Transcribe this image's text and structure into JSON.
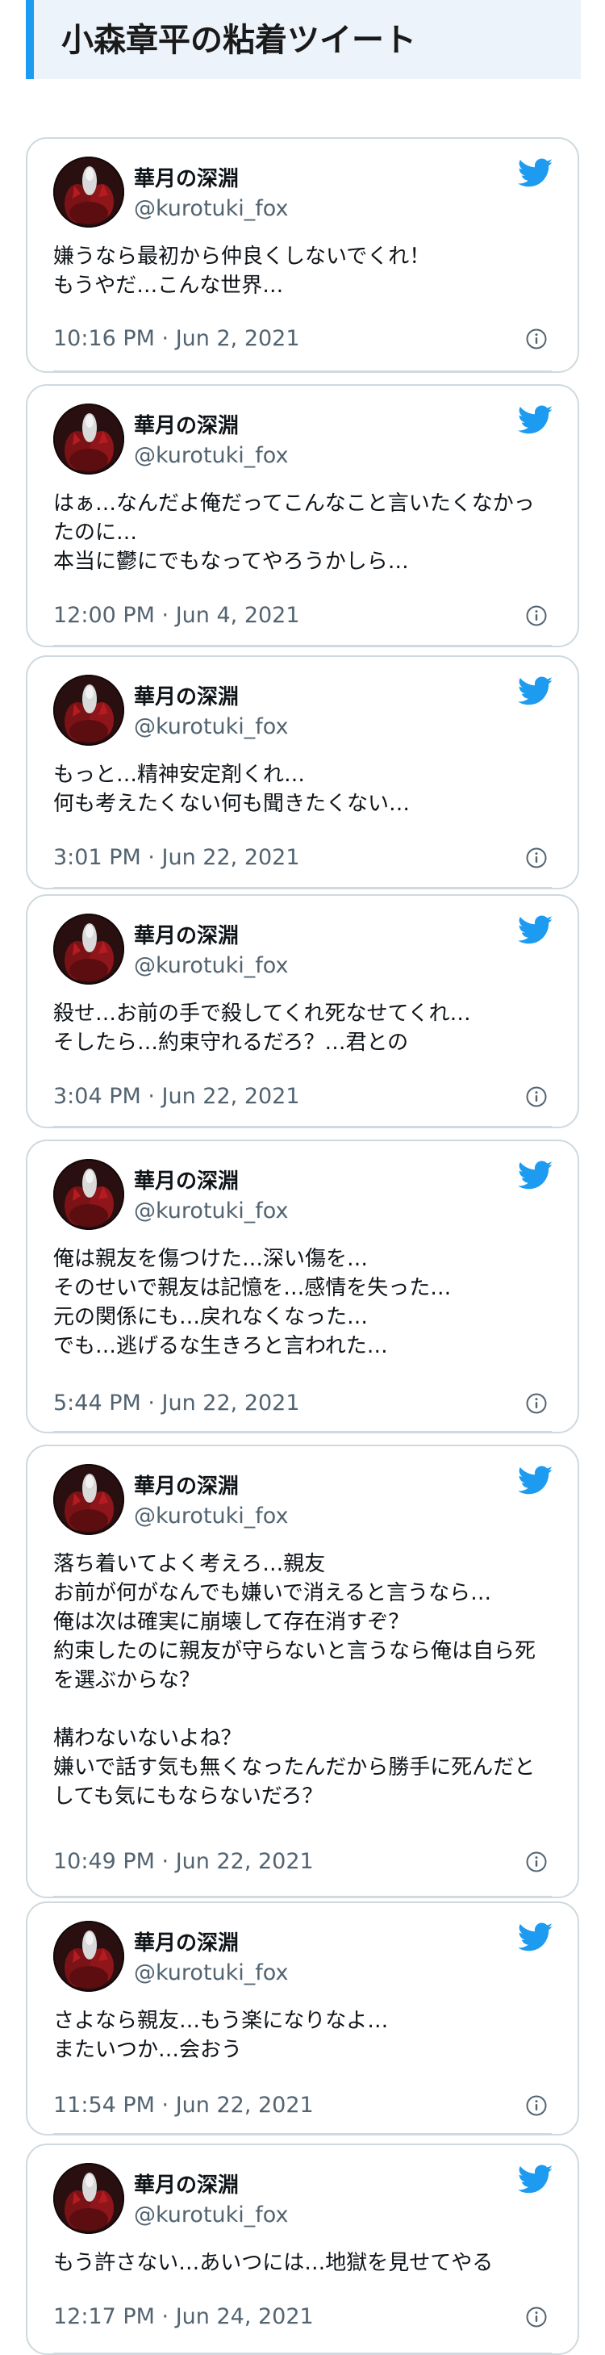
{
  "page": {
    "title": "小森章平の粘着ツイート"
  },
  "colors": {
    "accent": "#1d9bf0",
    "title_bg": "#edf3fb",
    "muted": "#536471",
    "border": "#cfd9de"
  },
  "icons": {
    "brand": "twitter-bird-icon",
    "info": "info-icon"
  },
  "tweets": [
    {
      "user": "華月の深淵",
      "handle": "@kurotuki_fox",
      "text": "嫌うなら最初から仲良くしないでくれ！\nもうやだ…こんな世界…",
      "time": "10:16 PM · Jun 2, 2021"
    },
    {
      "user": "華月の深淵",
      "handle": "@kurotuki_fox",
      "text": "はぁ…なんだよ俺だってこんなこと言いたくなかっ\nたのに…\n本当に鬱にでもなってやろうかしら…",
      "time": "12:00 PM · Jun 4, 2021"
    },
    {
      "user": "華月の深淵",
      "handle": "@kurotuki_fox",
      "text": "もっと…精神安定剤くれ…\n何も考えたくない何も聞きたくない…",
      "time": "3:01 PM · Jun 22, 2021"
    },
    {
      "user": "華月の深淵",
      "handle": "@kurotuki_fox",
      "text": "殺せ…お前の手で殺してくれ死なせてくれ…\nそしたら…約束守れるだろ？…君との",
      "time": "3:04 PM · Jun 22, 2021"
    },
    {
      "user": "華月の深淵",
      "handle": "@kurotuki_fox",
      "text": "俺は親友を傷つけた…深い傷を…\nそのせいで親友は記憶を…感情を失った…\n元の関係にも…戻れなくなった…\nでも…逃げるな生きろと言われた…",
      "time": "5:44 PM · Jun 22, 2021"
    },
    {
      "user": "華月の深淵",
      "handle": "@kurotuki_fox",
      "text": "落ち着いてよく考えろ…親友\nお前が何がなんでも嫌いで消えると言うなら…\n俺は次は確実に崩壊して存在消すぞ？\n約束したのに親友が守らないと言うなら俺は自ら死\nを選ぶからな？\n\n構わないないよね？\n嫌いで話す気も無くなったんだから勝手に死んだと\nしても気にもならないだろ？",
      "time": "10:49 PM · Jun 22, 2021"
    },
    {
      "user": "華月の深淵",
      "handle": "@kurotuki_fox",
      "text": "さよなら親友…もう楽になりなよ…\nまたいつか…会おう",
      "time": "11:54 PM · Jun 22, 2021"
    },
    {
      "user": "華月の深淵",
      "handle": "@kurotuki_fox",
      "text": "もう許さない…あいつには…地獄を見せてやる",
      "time": "12:17 PM · Jun 24, 2021"
    }
  ]
}
